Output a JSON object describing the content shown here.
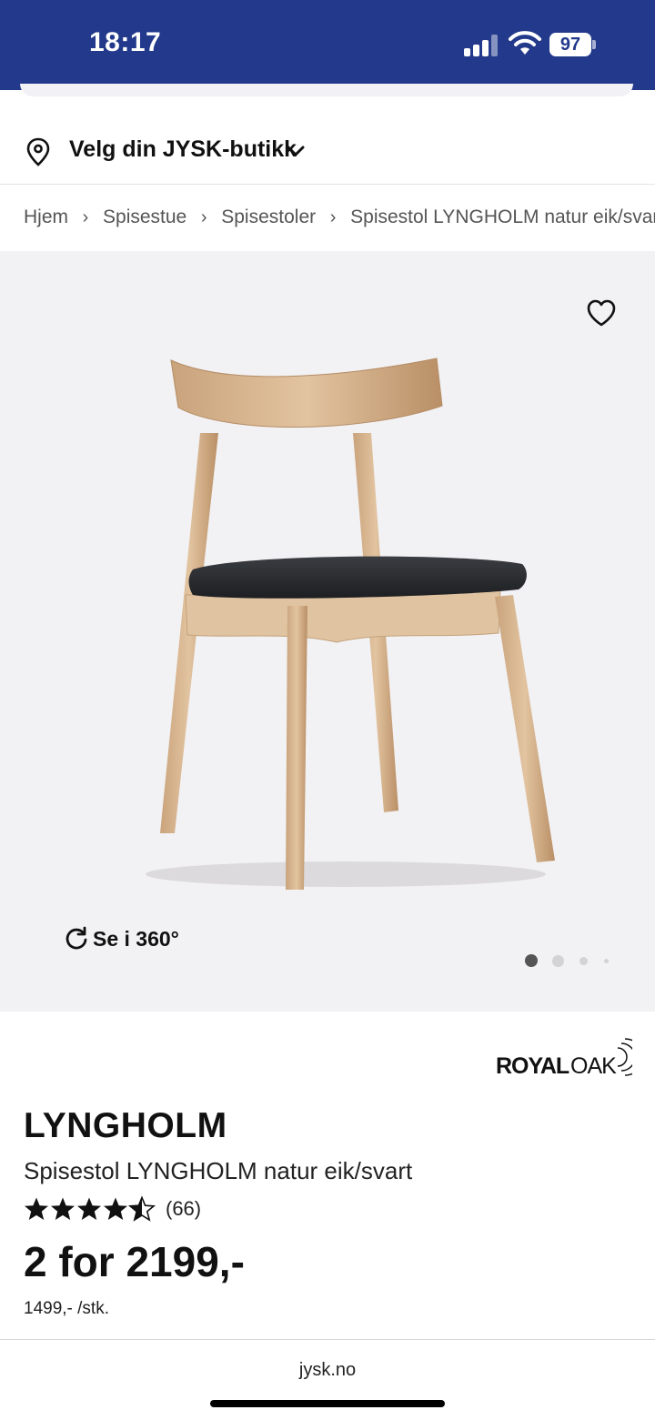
{
  "status_bar": {
    "time": "18:17",
    "battery": "97"
  },
  "store": {
    "label": "Velg din JYSK-butikk",
    "icon": "location-pin-icon"
  },
  "breadcrumb": {
    "items": [
      "Hjem",
      "Spisestue",
      "Spisestoler",
      "Spisestol LYNGHOLM natur eik/svart"
    ]
  },
  "gallery": {
    "spin_label": "Se i 360°",
    "slide_count": 4,
    "active_slide": 1
  },
  "product": {
    "brand": "ROYAL OAK",
    "brand_part1": "ROYAL",
    "brand_part2": "OAK",
    "name": "LYNGHOLM",
    "subtitle": "Spisestol LYNGHOLM natur eik/svart",
    "rating": 4.5,
    "review_count": "(66)",
    "price": "2 for 2199,-",
    "unit_price": "1499,- /stk."
  },
  "browser": {
    "url": "jysk.no"
  },
  "colors": {
    "header": "#233a8c",
    "gallery_bg": "#f2f1f3"
  }
}
